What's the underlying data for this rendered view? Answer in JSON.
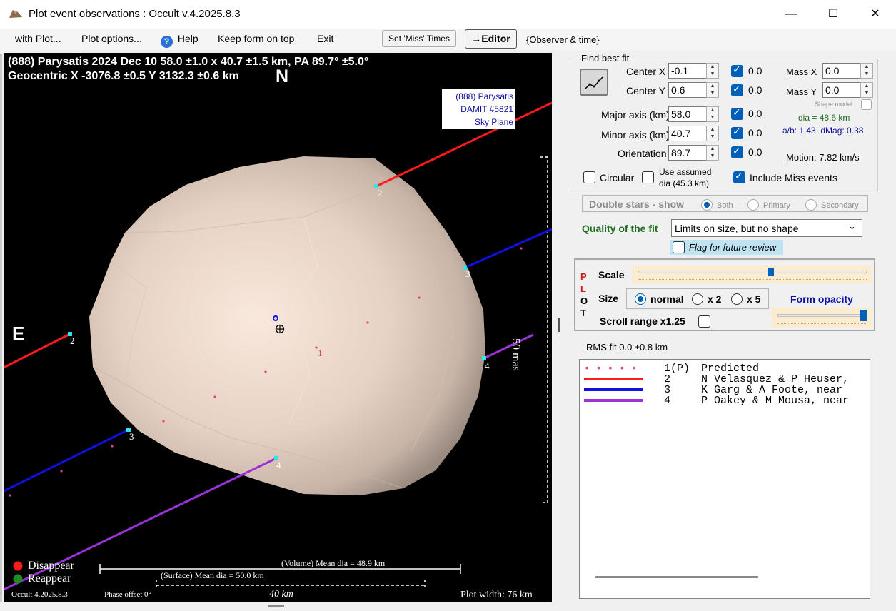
{
  "window": {
    "title": "Plot event observations : Occult v.4.2025.8.3",
    "minimize_glyph": "—",
    "maximize_glyph": "☐",
    "close_glyph": "✕"
  },
  "menu": {
    "with_plot": "with Plot...",
    "plot_options": "Plot options...",
    "help": "Help",
    "keep_on_top": "Keep form on top",
    "exit": "Exit",
    "set_miss_times": "Set 'Miss' Times",
    "editor": "→Editor",
    "observer_time": "{Observer & time}"
  },
  "plot": {
    "header_line1": "(888) Parysatis  2024 Dec 10  58.0 ±1.0 x 40.7 ±1.5 km, PA 89.7° ±5.0°",
    "header_line2": "Geocentric X  -3076.8 ±0.5  Y 3132.3 ±0.6 km",
    "north_label": "N",
    "east_label": "E",
    "model_box": [
      "(888) Parysatis",
      "DAMIT #5821",
      "Sky Plane"
    ],
    "scale_label": "50 mas",
    "chord_labels": [
      "2",
      "2",
      "3",
      "3",
      "4",
      "4",
      "1"
    ],
    "disappear_label": "Disappear",
    "reappear_label": "Reappear",
    "volume_dia": "(Volume) Mean dia = 48.9 km",
    "surface_dia": "(Surface) Mean dia = 50.0 km",
    "scale_km": "40 km",
    "version": "Occult 4.2025.8.3",
    "phase_offset": "Phase offset 0°",
    "plot_width": "Plot width: 76 km",
    "colors": {
      "chord2": "#ff1a1a",
      "chord3": "#1010e0",
      "chord4": "#9a32d8",
      "disappear": "#ff1a1a",
      "reappear": "#1e8c1e"
    }
  },
  "fit": {
    "group_label": "Find best fit",
    "center_x_label": "Center X",
    "center_x": "-0.1",
    "center_x_val": "0.0",
    "center_y_label": "Center Y",
    "center_y": "0.6",
    "center_y_val": "0.0",
    "major_label": "Major axis (km)",
    "major": "58.0",
    "major_val": "0.0",
    "minor_label": "Minor axis (km)",
    "minor": "40.7",
    "minor_val": "0.0",
    "orient_label": "Orientation",
    "orient": "89.7",
    "orient_val": "0.0",
    "mass_x_label": "Mass X",
    "mass_x": "0.0",
    "mass_y_label": "Mass Y",
    "mass_y": "0.0",
    "shape_model": "Shape model",
    "dia": "dia = 48.6 km",
    "ab": "a/b: 1.43, dMag: 0.38",
    "motion": "Motion: 7.82 km/s",
    "circular": "Circular",
    "use_assumed_1": "Use assumed",
    "use_assumed_2": "dia (45.3 km)",
    "include_miss": "Include Miss events"
  },
  "double_stars": {
    "label": "Double stars - show",
    "both": "Both",
    "primary": "Primary",
    "secondary": "Secondary"
  },
  "quality": {
    "label": "Quality of the fit",
    "value": "Limits on size, but no shape",
    "flag": "Flag for future review"
  },
  "plot_ctrl": {
    "vertical_label": [
      "P",
      "L",
      "O",
      "T"
    ],
    "scale": "Scale",
    "scale_level": 0.58,
    "size": "Size",
    "normal": "normal",
    "x2": "x 2",
    "x5": "x 5",
    "form_opacity": "Form opacity",
    "opacity_level": 0.97,
    "scroll_range": "Scroll range x1.25"
  },
  "rms": "RMS fit  0.0 ±0.8 km",
  "legend": [
    {
      "num": "1(P)",
      "text": "Predicted",
      "color": "#e0408a",
      "style": "dots"
    },
    {
      "num": "2",
      "text": "N Velasquez & P Heuser,",
      "color": "#ff1a1a",
      "style": "line"
    },
    {
      "num": "3",
      "text": "K Garg & A Foote, near",
      "color": "#1010e0",
      "style": "line"
    },
    {
      "num": "4",
      "text": "P Oakey & M Mousa, near",
      "color": "#9a32d8",
      "style": "line"
    }
  ]
}
